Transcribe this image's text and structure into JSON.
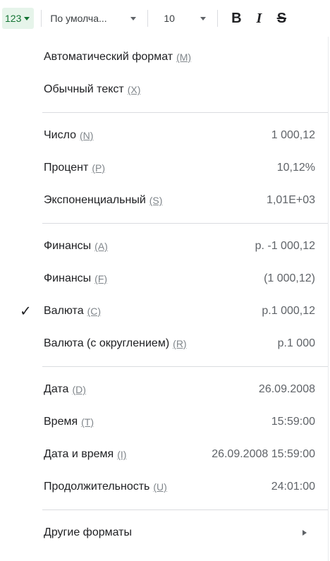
{
  "toolbar": {
    "format_label": "123",
    "font_label": "По умолча...",
    "size_label": "10",
    "bold_label": "B",
    "italic_label": "I",
    "strike_label": "S"
  },
  "menu": {
    "items": [
      {
        "label": "Автоматический формат",
        "key": "(M)"
      },
      {
        "label": "Обычный текст",
        "key": "(X)"
      },
      {
        "label": "Число",
        "key": "(N)",
        "example": "1 000,12"
      },
      {
        "label": "Процент",
        "key": "(P)",
        "example": "10,12%"
      },
      {
        "label": "Экспоненциальный",
        "key": "(S)",
        "example": "1,01E+03"
      },
      {
        "label": "Финансы",
        "key": "(A)",
        "example": "р. -1 000,12"
      },
      {
        "label": "Финансы",
        "key": "(F)",
        "example": "(1 000,12)"
      },
      {
        "label": "Валюта",
        "key": "(C)",
        "example": "р.1 000,12",
        "checked": "✓"
      },
      {
        "label": "Валюта (с округлением)",
        "key": "(R)",
        "example": "р.1 000"
      },
      {
        "label": "Дата",
        "key": "(D)",
        "example": "26.09.2008"
      },
      {
        "label": "Время",
        "key": "(T)",
        "example": "15:59:00"
      },
      {
        "label": "Дата и время",
        "key": "(I)",
        "example": "26.09.2008 15:59:00"
      },
      {
        "label": "Продолжительность",
        "key": "(U)",
        "example": "24:01:00"
      },
      {
        "label": "Другие форматы"
      }
    ]
  },
  "colors": {
    "format_button_bg": "#e6f4ea",
    "format_button_fg": "#137333",
    "divider": "#dadce0",
    "example_text": "#5f6368"
  },
  "icons": {
    "check": "checkmark-icon",
    "submenu": "triangle-right-icon"
  }
}
